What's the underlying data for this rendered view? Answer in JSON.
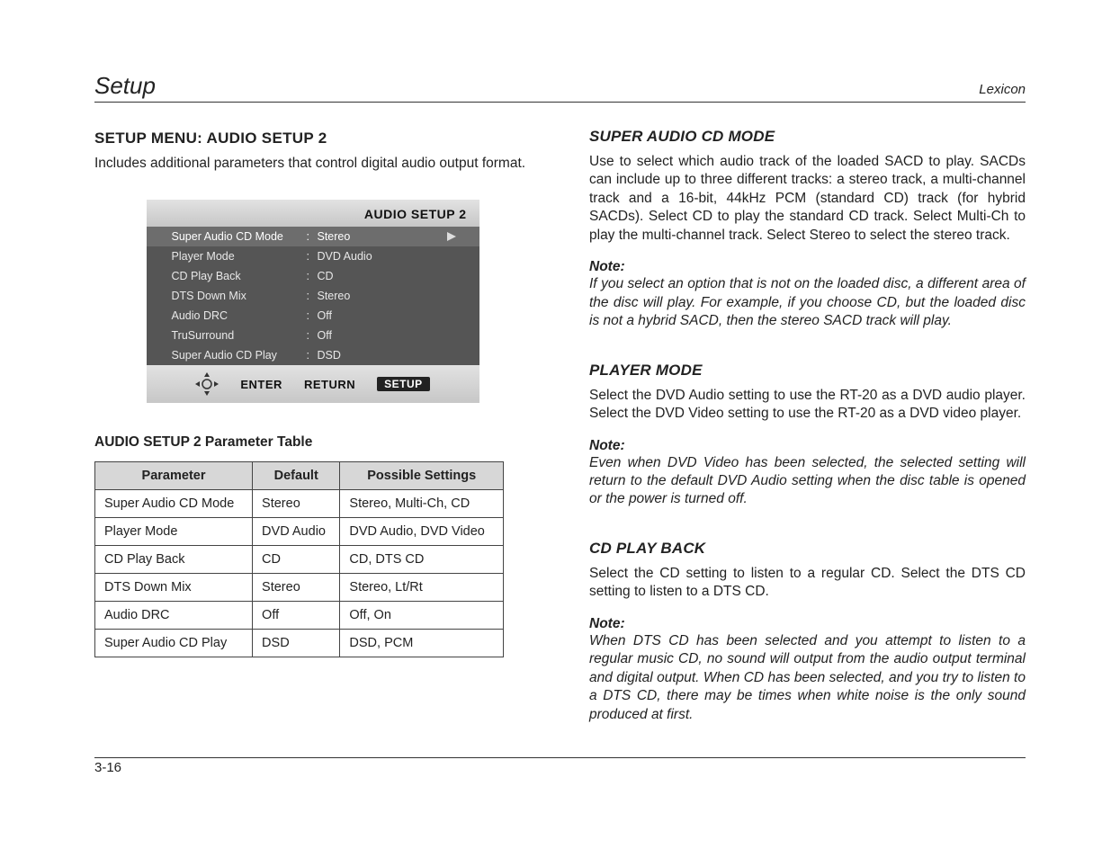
{
  "header": {
    "left": "Setup",
    "right": "Lexicon"
  },
  "left": {
    "heading": "SETUP MENU: AUDIO SETUP 2",
    "intro": "Includes additional parameters that control digital audio output format.",
    "osd": {
      "title": "AUDIO SETUP 2",
      "rows": [
        {
          "label": "Super Audio CD Mode",
          "value": "Stereo",
          "selected": true
        },
        {
          "label": "Player Mode",
          "value": "DVD Audio"
        },
        {
          "label": "CD Play Back",
          "value": "CD"
        },
        {
          "label": "DTS Down Mix",
          "value": "Stereo"
        },
        {
          "label": "Audio DRC",
          "value": "Off"
        },
        {
          "label": "TruSurround",
          "value": "Off"
        },
        {
          "label": "Super Audio CD Play",
          "value": "DSD"
        }
      ],
      "footer": {
        "enter": "ENTER",
        "return": "RETURN",
        "setup": "SETUP"
      }
    },
    "param_caption": "AUDIO SETUP 2 Parameter Table",
    "param_headers": {
      "c1": "Parameter",
      "c2": "Default",
      "c3": "Possible Settings"
    },
    "param_rows": [
      {
        "p": "Super Audio CD Mode",
        "d": "Stereo",
        "s": "Stereo, Multi-Ch, CD"
      },
      {
        "p": "Player Mode",
        "d": "DVD Audio",
        "s": "DVD Audio, DVD Video"
      },
      {
        "p": "CD Play Back",
        "d": "CD",
        "s": "CD, DTS CD"
      },
      {
        "p": "DTS Down Mix",
        "d": "Stereo",
        "s": "Stereo, Lt/Rt"
      },
      {
        "p": "Audio DRC",
        "d": "Off",
        "s": "Off, On"
      },
      {
        "p": "Super Audio CD Play",
        "d": "DSD",
        "s": "DSD, PCM"
      }
    ]
  },
  "right": {
    "s1_heading": "SUPER AUDIO CD MODE",
    "s1_body": "Use to select which audio track of the loaded SACD to play. SACDs can include up to three different tracks: a stereo track, a multi-channel track and a 16-bit, 44kHz PCM (standard CD) track (for hybrid SACDs). Select CD to play the standard CD track. Select Multi-Ch to play the multi-channel track. Select Stereo to select the stereo track.",
    "s1_note_label": "Note",
    "s1_note_colon": ":",
    "s1_note": "If you select an option that is not on the loaded disc, a different area of the disc will play. For example, if you choose CD, but the loaded disc is not a hybrid SACD, then the stereo SACD track will play.",
    "s2_heading": "PLAYER MODE",
    "s2_body": "Select the DVD Audio setting to use the RT-20 as a DVD audio player. Select the DVD Video setting to use the RT-20 as a DVD video player.",
    "s2_note_label": "Note",
    "s2_note_colon": ":",
    "s2_note": "Even when DVD Video has been selected, the selected setting will return to the default DVD Audio setting when the disc table is opened or the power is turned off.",
    "s3_heading": "CD PLAY BACK",
    "s3_body": "Select the CD setting to listen to a regular CD. Select the DTS CD setting to listen to a DTS CD.",
    "s3_note_label": "Note:",
    "s3_note": "When DTS CD has been selected and you attempt to listen to a regular music CD, no sound will output from the audio output terminal and digital output. When CD has been selected, and you try to listen to a DTS CD, there may be times when white noise is the only sound produced at first."
  },
  "footer": {
    "page": "3-16"
  }
}
